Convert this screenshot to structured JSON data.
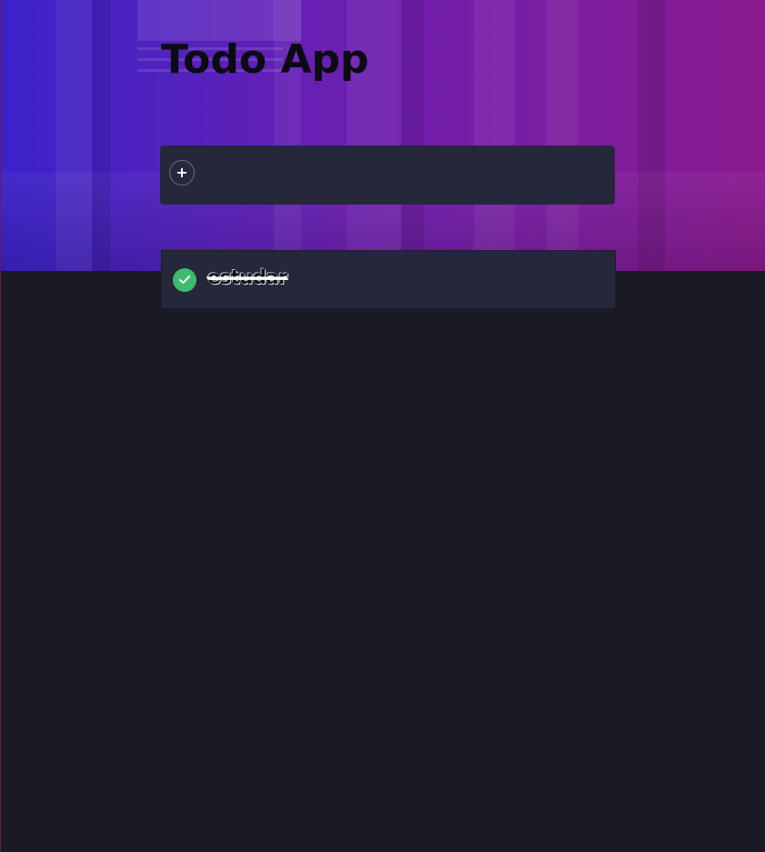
{
  "app": {
    "title": "Todo App"
  },
  "new_todo": {
    "add_button_symbol": "+",
    "value": "",
    "placeholder": ""
  },
  "todos": [
    {
      "text": "estudar",
      "completed": true
    }
  ],
  "colors": {
    "background": "#1a1a24",
    "card": "#25273a",
    "check": "#3dbb6e",
    "hero_gradient_start": "#3b22c9",
    "hero_gradient_end": "#8a1b8e"
  },
  "icons": {
    "add": "plus-icon",
    "completed": "check-icon"
  }
}
